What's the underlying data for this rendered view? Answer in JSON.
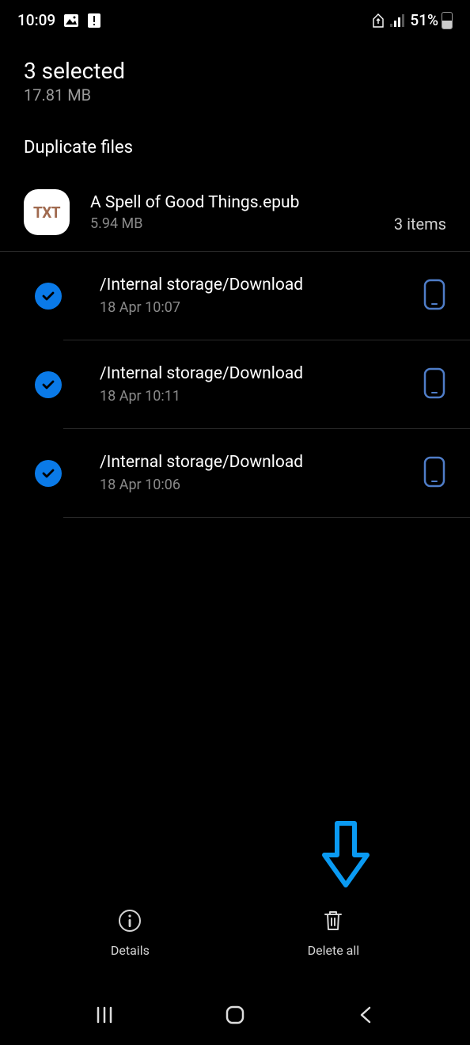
{
  "status": {
    "time": "10:09",
    "battery_pct": "51%"
  },
  "header": {
    "selected": "3 selected",
    "size": "17.81 MB"
  },
  "section_title": "Duplicate files",
  "group": {
    "icon_label": "TXT",
    "name": "A Spell of Good Things.epub",
    "size": "5.94 MB",
    "count": "3 items"
  },
  "items": [
    {
      "path": "/Internal storage/Download",
      "date": "18 Apr 10:07"
    },
    {
      "path": "/Internal storage/Download",
      "date": "18 Apr 10:11"
    },
    {
      "path": "/Internal storage/Download",
      "date": "18 Apr 10:06"
    }
  ],
  "toolbar": {
    "details": "Details",
    "delete_all": "Delete all"
  }
}
